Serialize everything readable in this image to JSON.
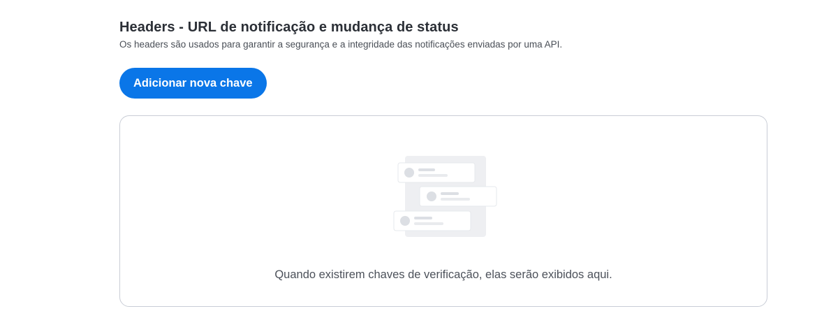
{
  "headers_section": {
    "title": "Headers - URL de notificação e mudança de status",
    "subtitle": "Os headers são usados para garantir a segurança e a integridade das notificações enviadas por uma API.",
    "add_button_label": "Adicionar nova chave",
    "empty_state": {
      "message": "Quando existirem chaves de verificação, elas serão exibidos aqui.",
      "illustration": "empty-list-illustration"
    }
  },
  "colors": {
    "primary_button": "#0a76e8",
    "title_text": "#2b2f36",
    "box_border": "#c9cdd6"
  }
}
